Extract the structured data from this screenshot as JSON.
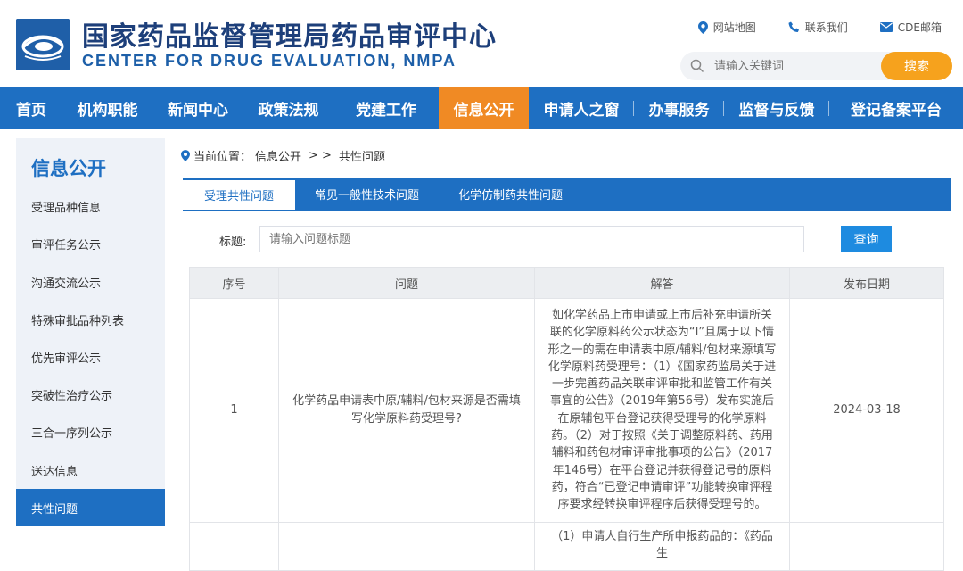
{
  "header": {
    "title": "国家药品监督管理局药品审评中心",
    "subtitle": "CENTER FOR DRUG EVALUATION, NMPA",
    "links": [
      "网站地图",
      "联系我们",
      "CDE邮箱"
    ],
    "search": {
      "placeholder": "请输入关键词",
      "button": "搜索"
    }
  },
  "nav": {
    "items": [
      "首页",
      "机构职能",
      "新闻中心",
      "政策法规",
      "党建工作",
      "信息公开",
      "申请人之窗",
      "办事服务",
      "监督与反馈",
      "登记备案平台"
    ],
    "active": "信息公开"
  },
  "sidebar": {
    "title": "信息公开",
    "items": [
      "受理品种信息",
      "审评任务公示",
      "沟通交流公示",
      "特殊审批品种列表",
      "优先审评公示",
      "突破性治疗公示",
      "三合一序列公示",
      "送达信息",
      "共性问题"
    ],
    "active": "共性问题"
  },
  "breadcrumb": {
    "prefix": "当前位置：",
    "path1": "信息公开",
    "separator": "> >",
    "path2": "共性问题"
  },
  "tabs": [
    "受理共性问题",
    "常见一般性技术问题",
    "化学仿制药共性问题"
  ],
  "filter": {
    "label": "标题:",
    "placeholder": "请输入问题标题",
    "button": "查询"
  },
  "table": {
    "headers": [
      "序号",
      "问题",
      "解答",
      "发布日期"
    ],
    "rows": [
      {
        "no": "1",
        "question": "化学药品申请表中原/辅料/包材来源是否需填写化学原料药受理号?",
        "answer": "如化学药品上市申请或上市后补充申请所关联的化学原料药公示状态为“I”且属于以下情形之一的需在申请表中原/辅料/包材来源填写化学原料药受理号：（1）《国家药监局关于进一步完善药品关联审评审批和监管工作有关事宜的公告》（2019年第56号）发布实施后在原辅包平台登记获得受理号的化学原料药。（2）对于按照《关于调整原料药、药用辅料和药包材审评审批事项的公告》（2017年146号）在平台登记并获得登记号的原料药，符合“已登记申请审评”功能转换审评程序要求经转换审评程序后获得受理号的。",
        "date": "2024-03-18"
      },
      {
        "no": "",
        "question": "",
        "answer": "（1）申请人自行生产所申报药品的：《药品生",
        "date": ""
      }
    ]
  }
}
